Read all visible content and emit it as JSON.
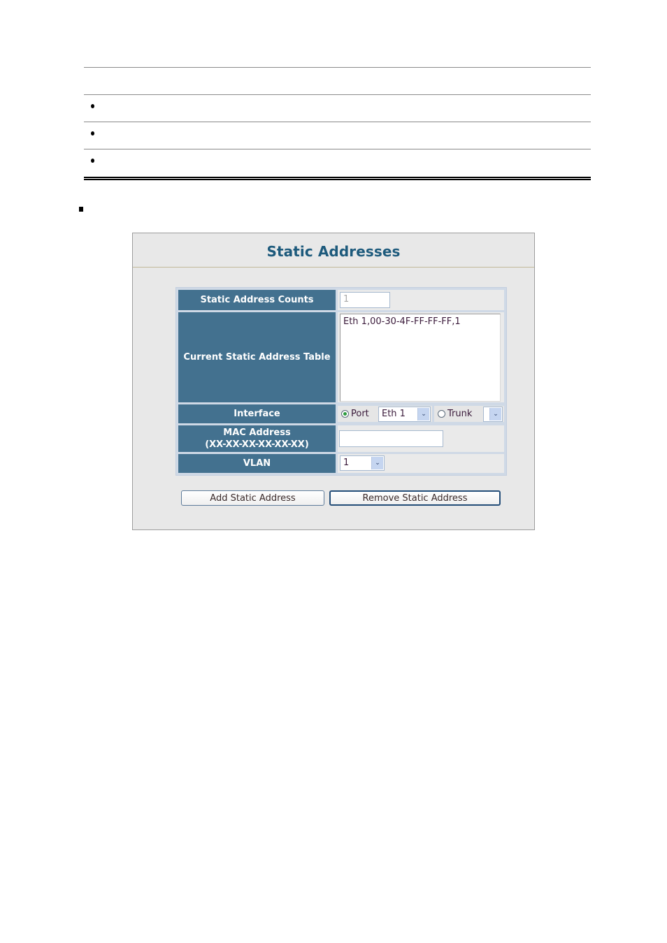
{
  "document": {
    "table_rows": [
      {
        "type": "header",
        "text": ""
      },
      {
        "type": "bullet",
        "text": ""
      },
      {
        "type": "bullet",
        "text": ""
      },
      {
        "type": "bullet",
        "text": ""
      }
    ]
  },
  "panel": {
    "title": "Static Addresses",
    "fields": {
      "counts": {
        "label": "Static Address Counts",
        "value": "1"
      },
      "table": {
        "label": "Current Static Address Table",
        "value": "Eth 1,00-30-4F-FF-FF-FF,1"
      },
      "interface": {
        "label": "Interface",
        "port_label": "Port",
        "port_selected": true,
        "port_value": "Eth 1",
        "trunk_label": "Trunk",
        "trunk_selected": false,
        "trunk_value": ""
      },
      "mac": {
        "label_line1": "MAC Address",
        "label_line2": "(XX-XX-XX-XX-XX-XX)",
        "value": "",
        "placeholder": ""
      },
      "vlan": {
        "label": "VLAN",
        "value": "1"
      }
    },
    "buttons": {
      "add": "Add Static Address",
      "remove": "Remove Static Address"
    },
    "icons": {
      "dropdown": "chevron-down-icon",
      "radio": "radio-icon"
    },
    "colors": {
      "title": "#1d5a7c",
      "label_bg": "#43718f",
      "panel_bg": "#e8e8e8"
    }
  }
}
